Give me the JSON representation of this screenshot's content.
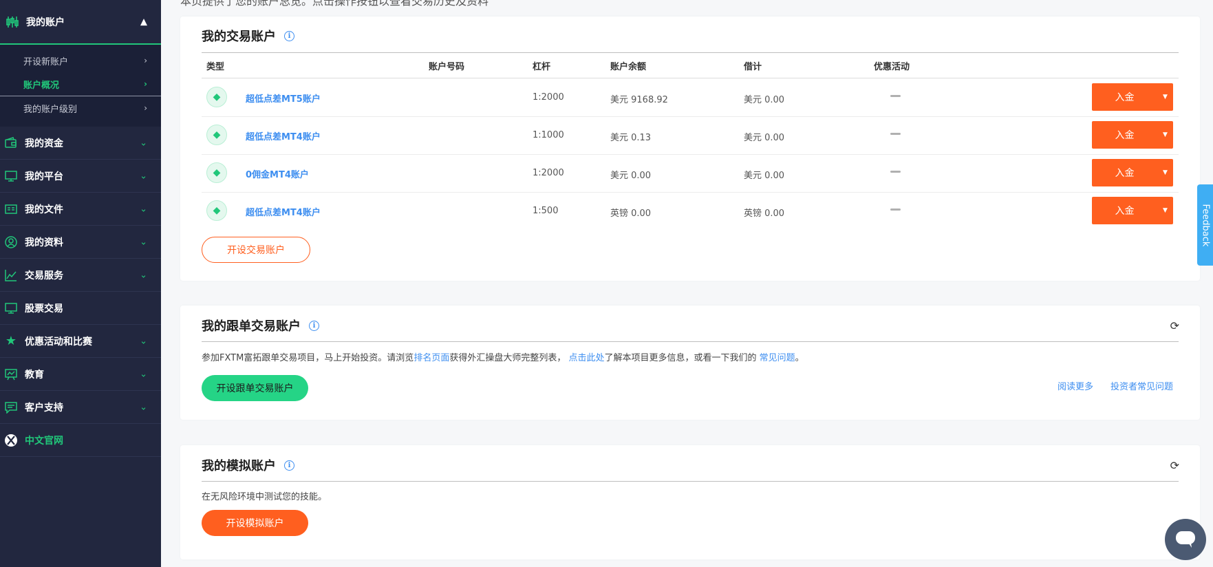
{
  "top_cut_text": "本页提供了您的账户总览。点击操作按钮以查看交易历史及资料",
  "sidebar": {
    "my_account": {
      "label": "我的账户",
      "icon": "candlestick-icon",
      "chevron": "chevron-up-icon"
    },
    "sub_items": [
      {
        "label": "开设新账户"
      },
      {
        "label": "账户概况"
      },
      {
        "label": "我的账户级别"
      }
    ],
    "items": [
      {
        "label": "我的资金",
        "icon": "wallet-icon"
      },
      {
        "label": "我的平台",
        "icon": "monitor-icon"
      },
      {
        "label": "我的文件",
        "icon": "document-icon"
      },
      {
        "label": "我的资料",
        "icon": "profile-icon"
      },
      {
        "label": "交易服务",
        "icon": "chart-line-icon"
      },
      {
        "label": "股票交易",
        "icon": "screen-icon"
      },
      {
        "label": "优惠活动和比赛",
        "icon": "star-icon"
      },
      {
        "label": "教育",
        "icon": "presentation-icon"
      },
      {
        "label": "客户支持",
        "icon": "chat-icon"
      },
      {
        "label": "中文官网",
        "icon": "globe-icon"
      }
    ],
    "accent": "#21c77a",
    "background": "#22273f"
  },
  "trading_accounts": {
    "title": "我的交易账户",
    "headers": {
      "type": "类型",
      "number": "账户号码",
      "leverage": "杠杆",
      "balance": "账户余额",
      "credit": "借计",
      "promo": "优惠活动"
    },
    "rows": [
      {
        "name": "超低点差MT5账户",
        "leverage": "1:2000",
        "balance": "美元 9168.92",
        "credit": "美元 0.00",
        "deposit": "入金"
      },
      {
        "name": "超低点差MT4账户",
        "leverage": "1:1000",
        "balance": "美元 0.13",
        "credit": "美元 0.00",
        "deposit": "入金"
      },
      {
        "name": "0佣金MT4账户",
        "leverage": "1:2000",
        "balance": "美元 0.00",
        "credit": "美元 0.00",
        "deposit": "入金"
      },
      {
        "name": "超低点差MT4账户",
        "leverage": "1:500",
        "balance": "英镑 0.00",
        "credit": "英镑 0.00",
        "deposit": "入金"
      }
    ],
    "open_button": "开设交易账户"
  },
  "copy_trading": {
    "title": "我的跟单交易账户",
    "desc_1": "参加FXTM富拓跟单交易项目，马上开始投资。请浏览",
    "link_1": "排名页面",
    "desc_2": "获得外汇操盘大师完整列表，",
    "link_2": "点击此处",
    "desc_3": "了解本项目更多信息，或看一下我们的",
    "link_3": "常见问题",
    "desc_4": "。",
    "open_button": "开设跟单交易账户",
    "read_more": "阅读更多",
    "investor_faq": "投资者常见问题"
  },
  "demo_accounts": {
    "title": "我的模拟账户",
    "desc": "在无风险环境中测试您的技能。",
    "open_button": "开设模拟账户"
  },
  "feedback": "Feedback",
  "colors": {
    "orange": "#ff5f1f",
    "green": "#25d486",
    "link": "#3d8ef0"
  }
}
